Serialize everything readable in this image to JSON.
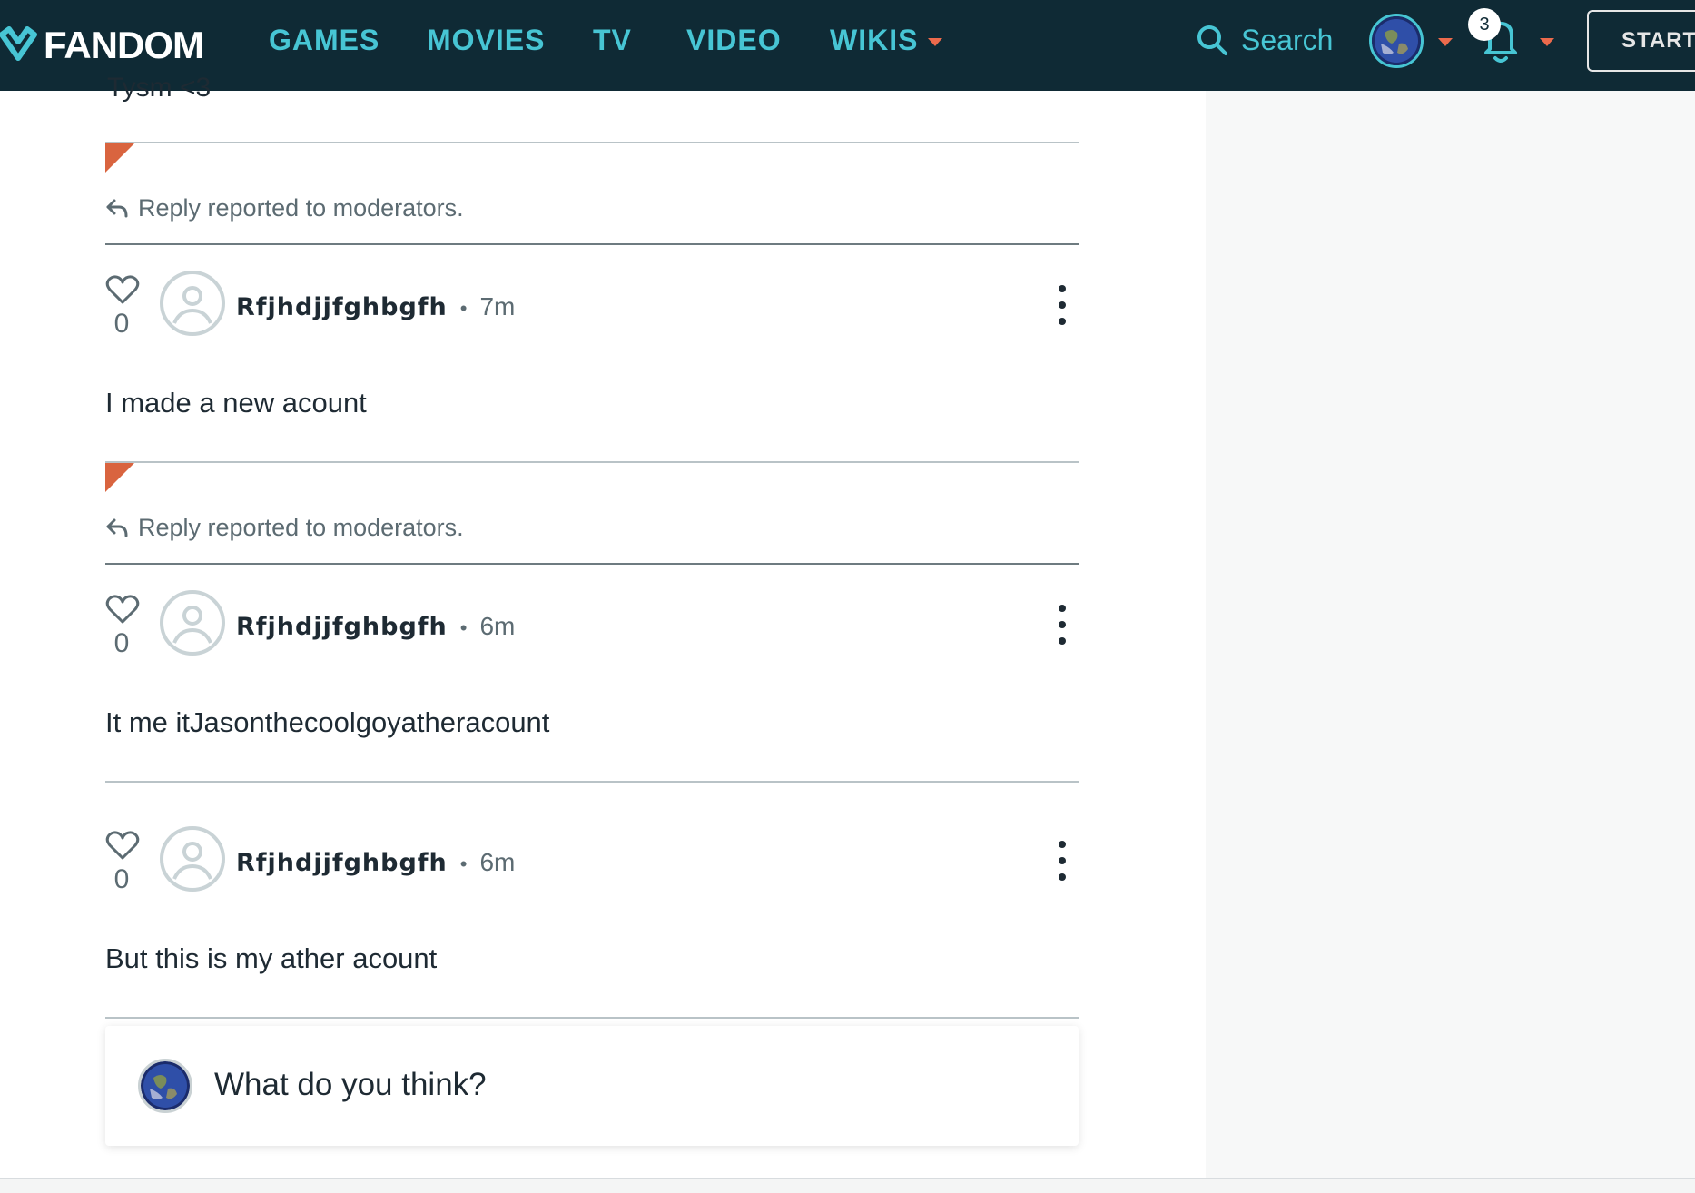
{
  "nav": {
    "logo_text": "FANDOM",
    "links": [
      "GAMES",
      "MOVIES",
      "TV",
      "VIDEO",
      "WIKIS"
    ],
    "search_label": "Search",
    "notification_count": "3",
    "start_label": "START"
  },
  "colors": {
    "nav_bg": "#0f2a35",
    "nav_link": "#47c5d4",
    "accent": "#ec6a4c",
    "flag": "#d9643f"
  },
  "thread": {
    "cut_off_text": "Tysm <3",
    "reported_text": "Reply reported to moderators.",
    "replies": [
      {
        "likes": "0",
        "username": "Rfjhdjjfghbgfh",
        "time": "7m",
        "body": "I made a new acount",
        "reported": true
      },
      {
        "likes": "0",
        "username": "Rfjhdjjfghbgfh",
        "time": "6m",
        "body": "It me itJasonthecoolgoyatheracount",
        "reported": false
      },
      {
        "likes": "0",
        "username": "Rfjhdjjfghbgfh",
        "time": "6m",
        "body": "But this is my ather acount",
        "reported": false
      }
    ],
    "separator": "•"
  },
  "composer": {
    "placeholder": "What do you think?"
  },
  "icons": [
    "fandom-logo-icon",
    "search-icon",
    "globe-avatar-icon",
    "bell-icon",
    "reply-arrow-icon",
    "heart-icon",
    "user-placeholder-icon",
    "kebab-menu-icon",
    "flag-icon"
  ]
}
